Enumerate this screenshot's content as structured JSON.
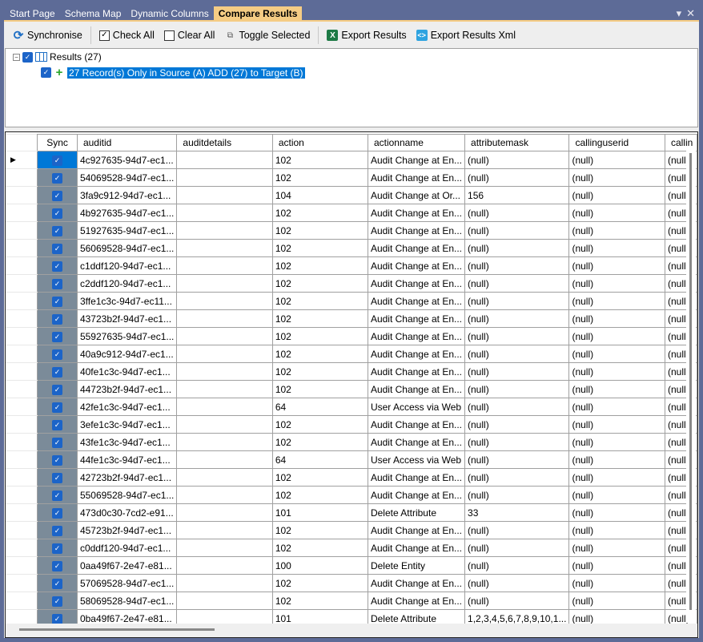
{
  "tabs": [
    {
      "label": "Start Page"
    },
    {
      "label": "Schema Map"
    },
    {
      "label": "Dynamic Columns"
    },
    {
      "label": "Compare Results",
      "active": true
    }
  ],
  "window_controls": {
    "dropdown": "▾",
    "close": "✕"
  },
  "toolbar": {
    "synchronise": "Synchronise",
    "check_all": "Check All",
    "clear_all": "Clear All",
    "toggle_selected": "Toggle Selected",
    "export_results": "Export Results",
    "export_results_xml": "Export Results Xml"
  },
  "tree": {
    "root": "Results (27)",
    "child": "27 Record(s) Only in Source (A) ADD (27) to Target (B)"
  },
  "colors": {
    "accent": "#0078d7",
    "tab_active": "#f5cc84",
    "frame": "#5d6b97",
    "sync_column": "#7b8b99"
  },
  "grid": {
    "columns": [
      "Sync",
      "auditid",
      "auditdetails",
      "action",
      "actionname",
      "attributemask",
      "callinguserid",
      "callin"
    ],
    "rows": [
      [
        "4c927635-94d7-ec1...",
        "",
        "102",
        "Audit Change at En...",
        "(null)",
        "(null)",
        "(null)"
      ],
      [
        "54069528-94d7-ec1...",
        "",
        "102",
        "Audit Change at En...",
        "(null)",
        "(null)",
        "(null)"
      ],
      [
        "3fa9c912-94d7-ec1...",
        "",
        "104",
        "Audit Change at Or...",
        "156",
        "(null)",
        "(null)"
      ],
      [
        "4b927635-94d7-ec1...",
        "",
        "102",
        "Audit Change at En...",
        "(null)",
        "(null)",
        "(null)"
      ],
      [
        "51927635-94d7-ec1...",
        "",
        "102",
        "Audit Change at En...",
        "(null)",
        "(null)",
        "(null)"
      ],
      [
        "56069528-94d7-ec1...",
        "",
        "102",
        "Audit Change at En...",
        "(null)",
        "(null)",
        "(null)"
      ],
      [
        "c1ddf120-94d7-ec1...",
        "",
        "102",
        "Audit Change at En...",
        "(null)",
        "(null)",
        "(null)"
      ],
      [
        "c2ddf120-94d7-ec1...",
        "",
        "102",
        "Audit Change at En...",
        "(null)",
        "(null)",
        "(null)"
      ],
      [
        "3ffe1c3c-94d7-ec11...",
        "",
        "102",
        "Audit Change at En...",
        "(null)",
        "(null)",
        "(null)"
      ],
      [
        "43723b2f-94d7-ec1...",
        "",
        "102",
        "Audit Change at En...",
        "(null)",
        "(null)",
        "(null)"
      ],
      [
        "55927635-94d7-ec1...",
        "",
        "102",
        "Audit Change at En...",
        "(null)",
        "(null)",
        "(null)"
      ],
      [
        "40a9c912-94d7-ec1...",
        "",
        "102",
        "Audit Change at En...",
        "(null)",
        "(null)",
        "(null)"
      ],
      [
        "40fe1c3c-94d7-ec1...",
        "",
        "102",
        "Audit Change at En...",
        "(null)",
        "(null)",
        "(null)"
      ],
      [
        "44723b2f-94d7-ec1...",
        "",
        "102",
        "Audit Change at En...",
        "(null)",
        "(null)",
        "(null)"
      ],
      [
        "42fe1c3c-94d7-ec1...",
        "",
        "64",
        "User Access via Web",
        "(null)",
        "(null)",
        "(null)"
      ],
      [
        "3efe1c3c-94d7-ec1...",
        "",
        "102",
        "Audit Change at En...",
        "(null)",
        "(null)",
        "(null)"
      ],
      [
        "43fe1c3c-94d7-ec1...",
        "",
        "102",
        "Audit Change at En...",
        "(null)",
        "(null)",
        "(null)"
      ],
      [
        "44fe1c3c-94d7-ec1...",
        "",
        "64",
        "User Access via Web",
        "(null)",
        "(null)",
        "(null)"
      ],
      [
        "42723b2f-94d7-ec1...",
        "",
        "102",
        "Audit Change at En...",
        "(null)",
        "(null)",
        "(null)"
      ],
      [
        "55069528-94d7-ec1...",
        "",
        "102",
        "Audit Change at En...",
        "(null)",
        "(null)",
        "(null)"
      ],
      [
        "473d0c30-7cd2-e91...",
        "",
        "101",
        "Delete Attribute",
        "33",
        "(null)",
        "(null)"
      ],
      [
        "45723b2f-94d7-ec1...",
        "",
        "102",
        "Audit Change at En...",
        "(null)",
        "(null)",
        "(null)"
      ],
      [
        "c0ddf120-94d7-ec1...",
        "",
        "102",
        "Audit Change at En...",
        "(null)",
        "(null)",
        "(null)"
      ],
      [
        "0aa49f67-2e47-e81...",
        "",
        "100",
        "Delete Entity",
        "(null)",
        "(null)",
        "(null)"
      ],
      [
        "57069528-94d7-ec1...",
        "",
        "102",
        "Audit Change at En...",
        "(null)",
        "(null)",
        "(null)"
      ],
      [
        "58069528-94d7-ec1...",
        "",
        "102",
        "Audit Change at En...",
        "(null)",
        "(null)",
        "(null)"
      ],
      [
        "0ba49f67-2e47-e81...",
        "",
        "101",
        "Delete Attribute",
        "1,2,3,4,5,6,7,8,9,10,1...",
        "(null)",
        "(null)"
      ]
    ]
  }
}
